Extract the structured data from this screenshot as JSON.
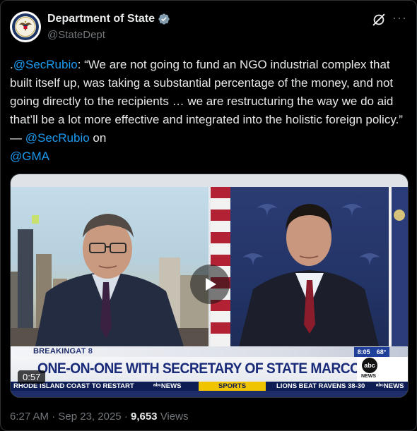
{
  "author": {
    "name": "Department of State",
    "handle": "@StateDept"
  },
  "tweet": {
    "prefix": ".",
    "mention1": "@SecRubio",
    "body": ": “We are not going to fund an NGO industrial complex that built itself up, was taking a substantial percentage of the money, and not going directly to the recipients … we are restructuring the way we do aid that’ll be a lot more effective and integrated into the holistic foreign policy.” — ",
    "mention2": "@SecRubio",
    "on": " on ",
    "mention3": "@GMA"
  },
  "video": {
    "breaking": "BREAKING",
    "breaking_at": "AT 8",
    "headline": "ONE-ON-ONE WITH SECRETARY OF STATE MARCO RUBIO",
    "clock": "8:05",
    "temp": "68°",
    "abc": "abc",
    "news": "NEWS",
    "ticker1": "RHODE ISLAND COAST TO RESTART",
    "ticker_news1": "NEWS",
    "ticker_sports": "SPORTS",
    "ticker2": "LIONS BEAT RAVENS 38-30",
    "ticker_news2": "NEWS",
    "duration": "0:57"
  },
  "meta": {
    "time": "6:27 AM",
    "sep1": " · ",
    "date": "Sep 23, 2025",
    "sep2": " · ",
    "views_count": "9,653",
    "views_label": " Views"
  },
  "icons": {
    "verified": "gray-checkmark-badge",
    "grok": "grok-icon",
    "more": "more-icon",
    "play": "play-icon"
  },
  "colors": {
    "link": "#1d9bf0",
    "muted": "#71767b",
    "text": "#e7e9ea",
    "verified": "#829aab"
  }
}
